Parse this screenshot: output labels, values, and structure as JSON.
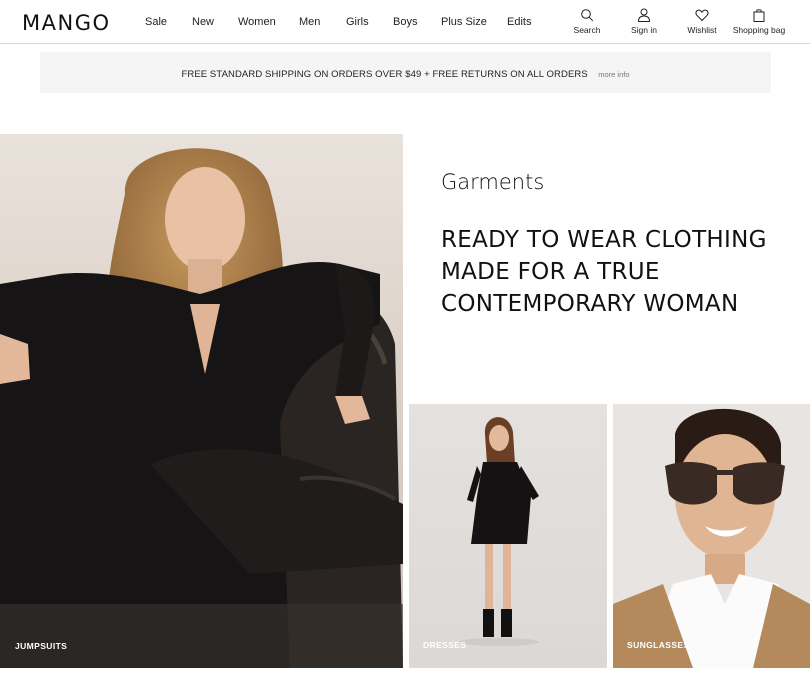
{
  "header": {
    "logo": "MANGO",
    "nav": [
      "Sale",
      "New",
      "Women",
      "Men",
      "Girls",
      "Boys",
      "Plus Size",
      "Edits"
    ],
    "utilities": {
      "search": "Search",
      "sign_in": "Sign in",
      "wishlist": "Wishlist",
      "bag": "Shopping bag"
    }
  },
  "banner": {
    "text": "FREE STANDARD SHIPPING ON ORDERS OVER $49 + FREE RETURNS ON ALL ORDERS",
    "link": "more info"
  },
  "content": {
    "kicker": "Garments",
    "headline": "READY TO WEAR CLOTHING MADE FOR A TRUE CONTEMPORARY WOMAN"
  },
  "tiles": {
    "jumpsuits": "JUMPSUITS",
    "dresses": "DRESSES",
    "sunglasses": "SUNGLASSES"
  }
}
